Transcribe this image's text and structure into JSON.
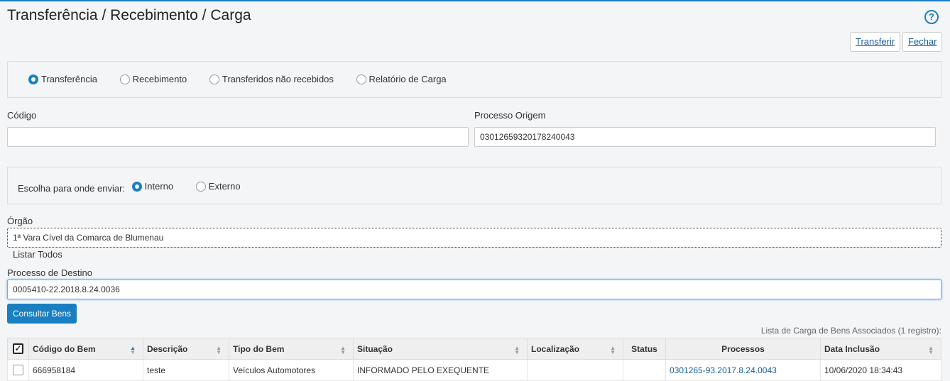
{
  "page": {
    "title": "Transferência / Recebimento / Carga",
    "help": "?"
  },
  "toolbar": {
    "transferir": "Transferir",
    "fechar": "Fechar"
  },
  "mode_options": [
    "Transferência",
    "Recebimento",
    "Transferidos não recebidos",
    "Relatório de Carga"
  ],
  "fields": {
    "codigo_label": "Código",
    "codigo_value": "",
    "processo_origem_label": "Processo Origem",
    "processo_origem_value": "03012659320178240043"
  },
  "destino": {
    "label": "Escolha para onde enviar:",
    "options": [
      "Interno",
      "Externo"
    ]
  },
  "orgao": {
    "label": "Órgão",
    "value": "1ª Vara Cível da Comarca de Blumenau",
    "listar_todos": "Listar Todos"
  },
  "processo_destino": {
    "label": "Processo de Destino",
    "value": "0005410-22.2018.8.24.0036"
  },
  "consultar_label": "Consultar Bens",
  "table": {
    "caption": "Lista de Carga de Bens Associados (1 registro):",
    "select_all": "✓",
    "headers": [
      "Código do Bem",
      "Descrição",
      "Tipo do Bem",
      "Situação",
      "Localização",
      "Status",
      "Processos",
      "Data Inclusão"
    ],
    "rows": [
      [
        "666958184",
        "teste",
        "Veículos Automotores",
        "INFORMADO PELO EXEQUENTE",
        "",
        "",
        "0301265-93.2017.8.24.0043",
        "10/06/2020 18:34:43"
      ]
    ]
  },
  "colors": {
    "accent": "#1a7fc0"
  }
}
